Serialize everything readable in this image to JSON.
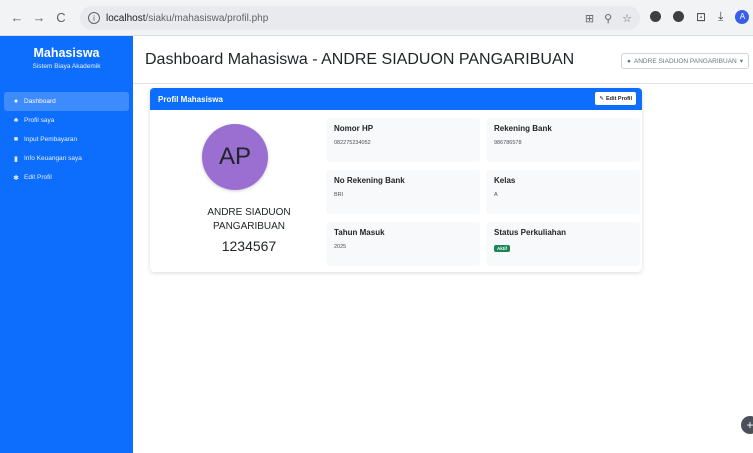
{
  "browser": {
    "back_icon": "←",
    "forward_icon": "→",
    "reload_icon": "C",
    "url_host": "localhost",
    "url_path": "/siaku/mahasiswa/profil.php",
    "profile_initial": "A"
  },
  "sidebar": {
    "title": "Mahasiswa",
    "subtitle": "Sistem Biaya Akademik",
    "items": [
      {
        "label": "Dashboard",
        "icon": "●"
      },
      {
        "label": "Profil saya",
        "icon": "♣"
      },
      {
        "label": "Input Pembayaran",
        "icon": "■"
      },
      {
        "label": "Info Keuangan saya",
        "icon": "▮"
      },
      {
        "label": "Edit Profil",
        "icon": "✱"
      }
    ]
  },
  "header": {
    "title": "Dashboard Mahasiswa - ANDRE SIADUON PANGARIBUAN",
    "user_menu": "ANDRE SIADUON PANGARIBUAN"
  },
  "profile": {
    "card_title": "Profil Mahasiswa",
    "edit_label": "Edit Profil",
    "avatar_initials": "AP",
    "name": "ANDRE SIADUON PANGARIBUAN",
    "nim": "1234567",
    "fields": {
      "hp_label": "Nomor HP",
      "hp_value": "082275234052",
      "bank_label": "Rekening Bank",
      "bank_value": "986786578",
      "norek_label": "No Rekening Bank",
      "norek_value": "BRI",
      "kelas_label": "Kelas",
      "kelas_value": "A",
      "tahun_label": "Tahun Masuk",
      "tahun_value": "2025",
      "status_label": "Status Perkuliahan",
      "status_value": "Aktif"
    }
  },
  "colors": {
    "primary": "#0d6efd",
    "success": "#198754",
    "avatar": "#9a6fd1"
  }
}
